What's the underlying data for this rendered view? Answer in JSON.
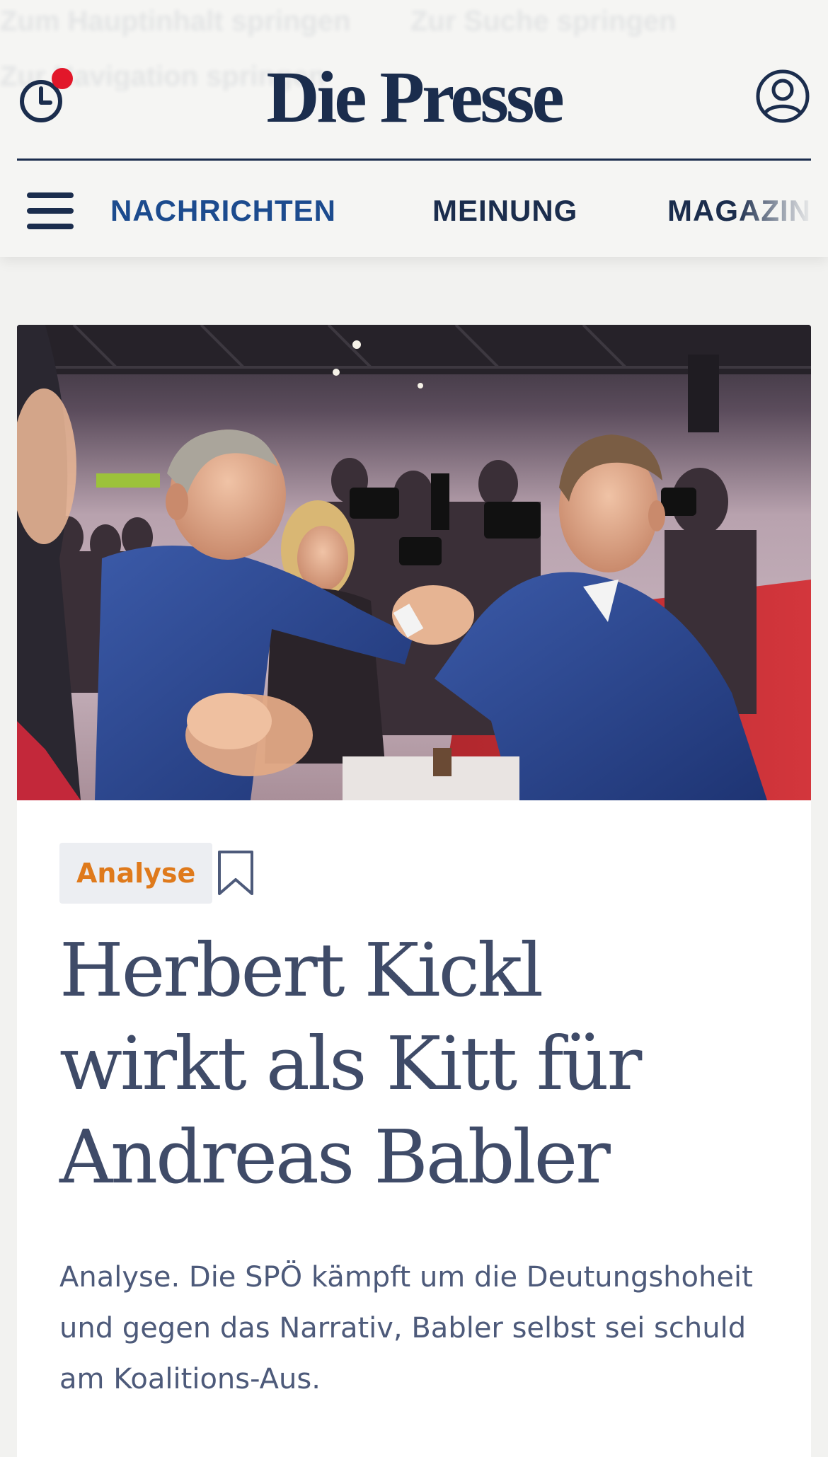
{
  "header": {
    "logo": "Die Presse",
    "ghost_links": [
      "Zum Hauptinhalt springen",
      "Zur Suche springen",
      "Zur Navigation springen"
    ],
    "history_icon": "history-clock-icon",
    "account_icon": "user-account-icon",
    "notification_color": "#e2172a"
  },
  "nav": {
    "menu_icon": "hamburger-menu-icon",
    "items": [
      {
        "label": "NACHRICHTEN",
        "active": true
      },
      {
        "label": "MEINUNG",
        "active": false
      },
      {
        "label": "MAGAZIN",
        "active": false
      }
    ]
  },
  "article": {
    "image_alt": "Handshake at SPÖ party event",
    "tag": "Analyse",
    "bookmark_icon": "bookmark-icon",
    "headline_lines": [
      "Herbert Kickl",
      "wirkt als Kitt für",
      "Andreas Babler"
    ],
    "teaser": "Analyse. Die SPÖ kämpft um die Deutungshoheit und gegen das Narrativ, Babler selbst sei schuld am Koalitions-Aus."
  },
  "colors": {
    "brand_navy": "#1b2d4d",
    "active_nav": "#1c4b8e",
    "tag_orange": "#df7a1c",
    "headline": "#3f4b68"
  }
}
